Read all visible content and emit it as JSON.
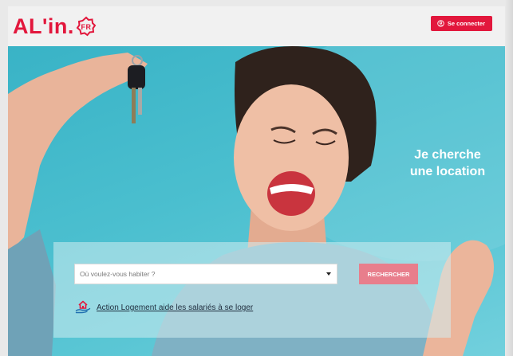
{
  "brand": {
    "logo_text": "AL'in.",
    "logo_badge": "FR",
    "accent_color": "#e2173c"
  },
  "header": {
    "login_label": "Se connecter",
    "login_icon": "user-circle-icon"
  },
  "hero": {
    "title_line1": "Je cherche",
    "title_line2": "une location",
    "background_color": "#4bbfcf"
  },
  "search": {
    "placeholder": "Où voulez-vous habiter ?",
    "dropdown_icon": "caret-down-icon",
    "button_label": "RECHERCHER",
    "button_color": "#e87e8c"
  },
  "footer_link": {
    "label": "Action Logement aide les salariés à se loger",
    "icon": "house-hand-icon"
  }
}
